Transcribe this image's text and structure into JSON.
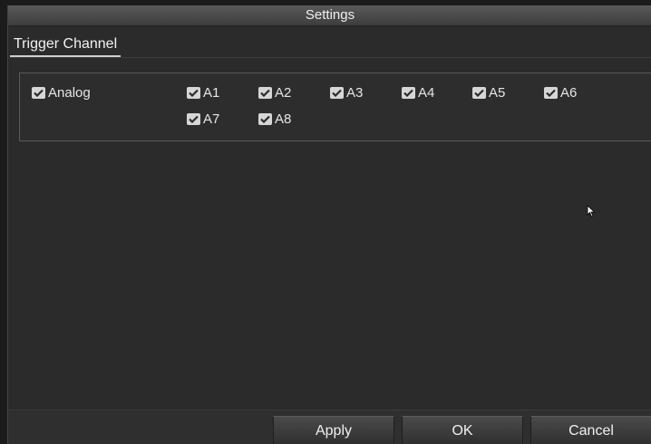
{
  "window": {
    "title": "Settings"
  },
  "tabs": [
    {
      "label": "Trigger Channel"
    }
  ],
  "analog": {
    "label": "Analog",
    "checked": true,
    "channels": [
      {
        "label": "A1",
        "checked": true
      },
      {
        "label": "A2",
        "checked": true
      },
      {
        "label": "A3",
        "checked": true
      },
      {
        "label": "A4",
        "checked": true
      },
      {
        "label": "A5",
        "checked": true
      },
      {
        "label": "A6",
        "checked": true
      },
      {
        "label": "A7",
        "checked": true
      },
      {
        "label": "A8",
        "checked": true
      }
    ]
  },
  "buttons": {
    "apply": "Apply",
    "ok": "OK",
    "cancel": "Cancel"
  },
  "icons": {
    "checkbox": "checkmark-icon",
    "cursor": "mouse-pointer-icon"
  },
  "colors": {
    "background": "#2b2b2b",
    "titlebar": "#4a4a4a",
    "checkbox": "#d6d6d6"
  }
}
